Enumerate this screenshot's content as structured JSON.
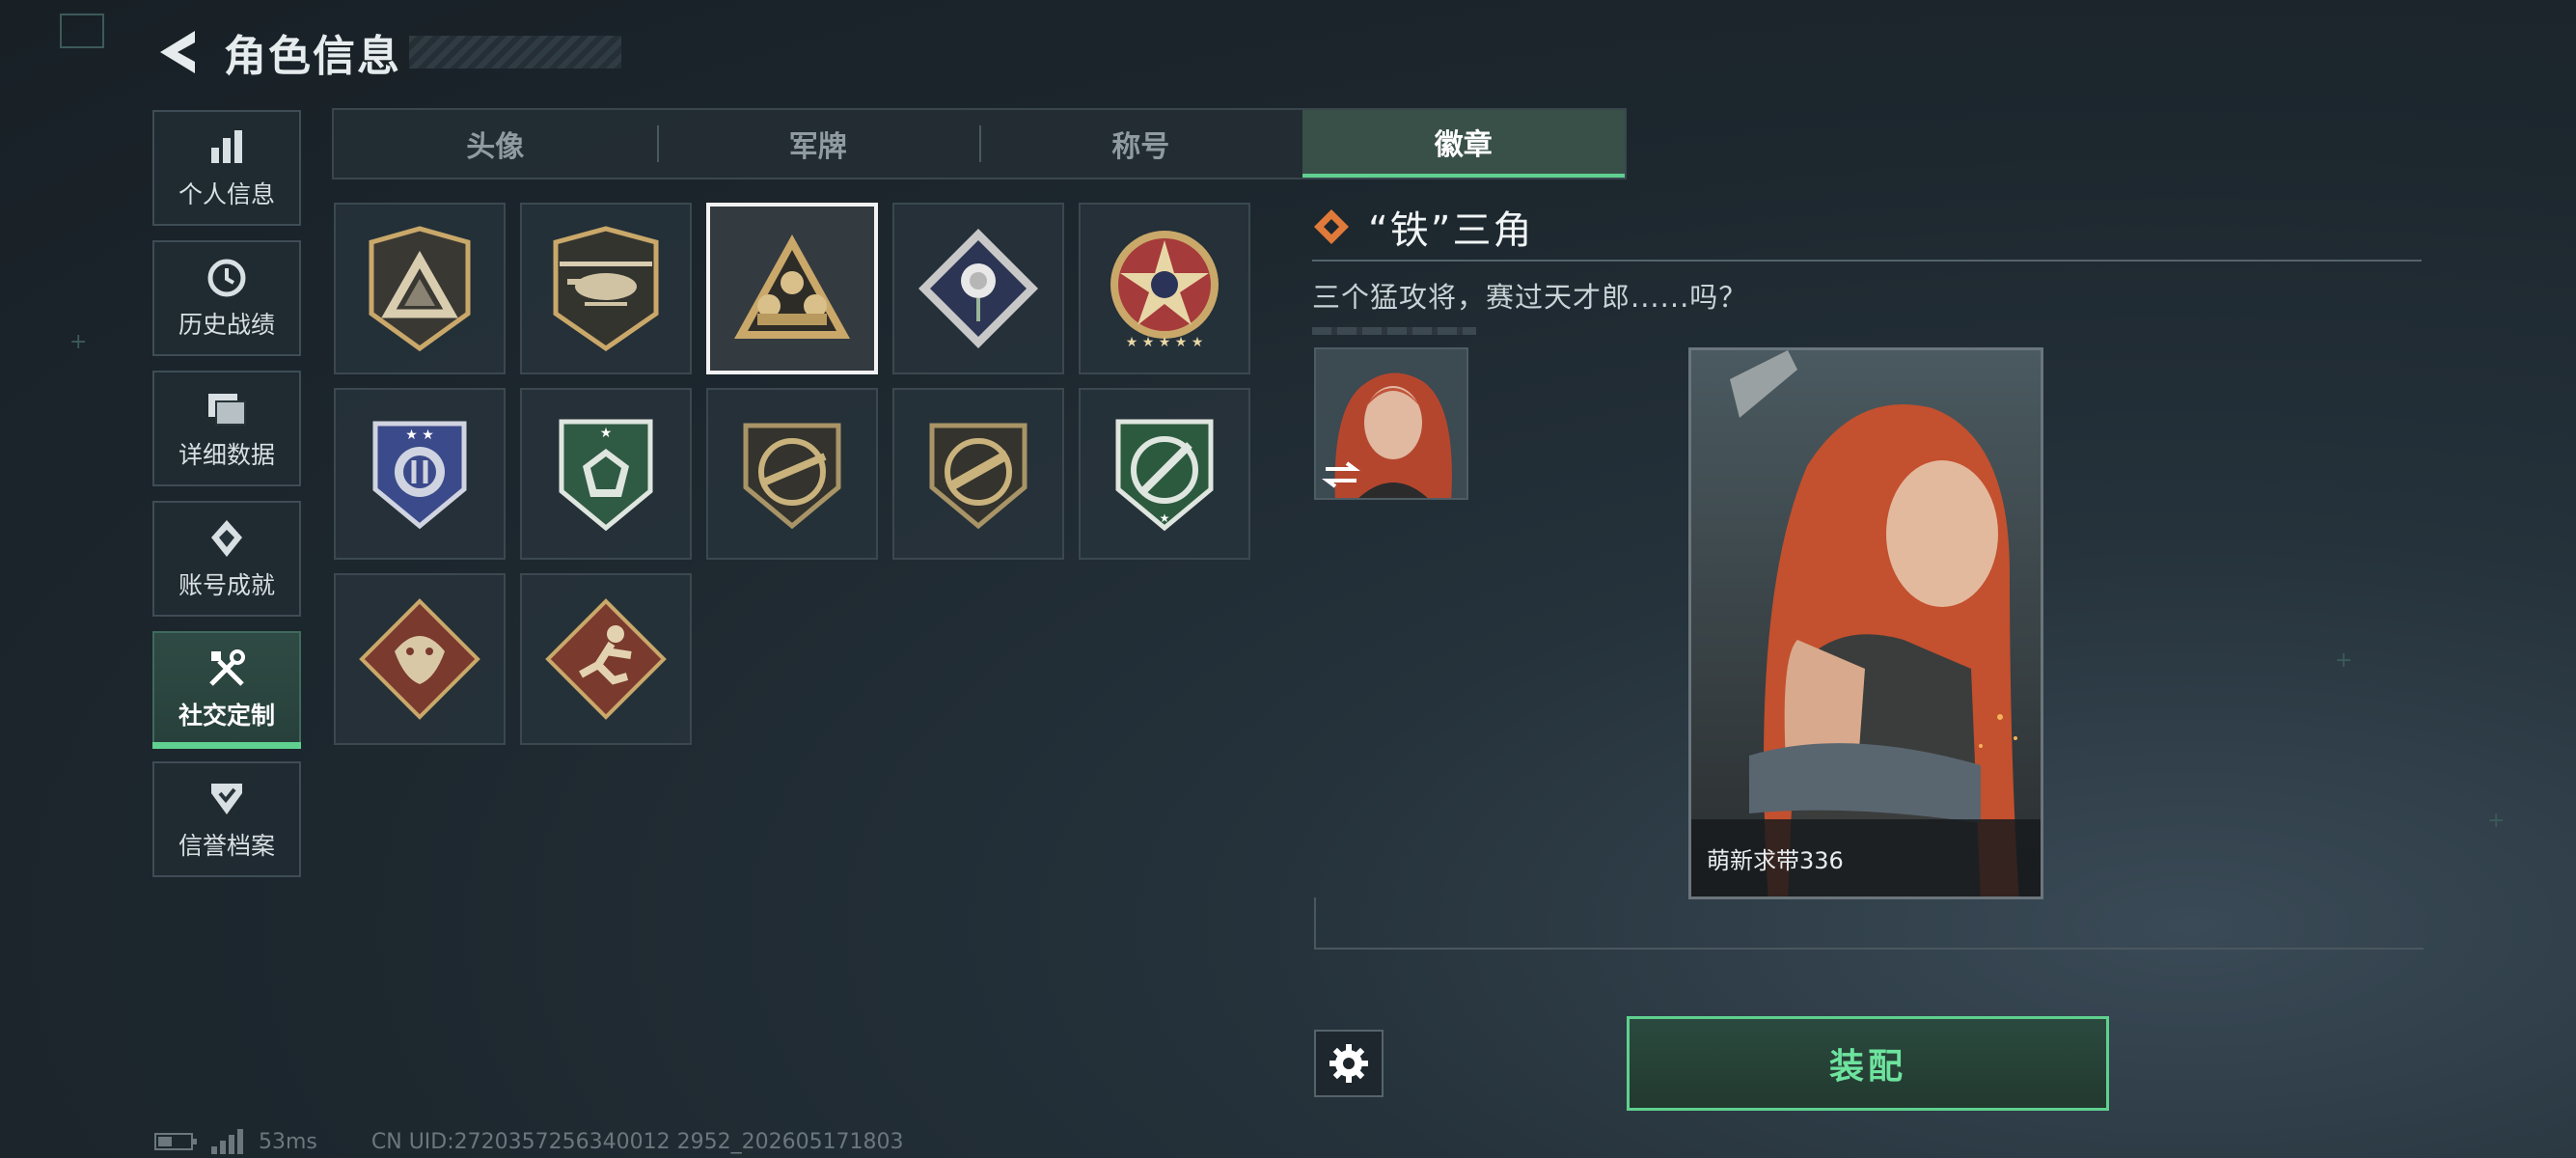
{
  "header": {
    "title": "角色信息",
    "back_icon": "back-arrow-icon"
  },
  "sidebar": {
    "items": [
      {
        "label": "个人信息",
        "icon": "bar-chart-icon",
        "active": false
      },
      {
        "label": "历史战绩",
        "icon": "clock-icon",
        "active": false
      },
      {
        "label": "详细数据",
        "icon": "folder-icon",
        "active": false
      },
      {
        "label": "账号成就",
        "icon": "medal-icon",
        "active": false
      },
      {
        "label": "社交定制",
        "icon": "tools-icon",
        "active": true
      },
      {
        "label": "信誉档案",
        "icon": "shield-check-icon",
        "active": false
      }
    ]
  },
  "tabs": [
    {
      "label": "头像",
      "active": false
    },
    {
      "label": "军牌",
      "active": false
    },
    {
      "label": "称号",
      "active": false
    },
    {
      "label": "徽章",
      "active": true
    }
  ],
  "badges": [
    {
      "name": "triangle-shield-badge",
      "selected": false
    },
    {
      "name": "helicopter-badge",
      "selected": false
    },
    {
      "name": "iron-triangle-badge",
      "selected": true
    },
    {
      "name": "rose-diamond-badge",
      "selected": false
    },
    {
      "name": "star-skull-badge",
      "selected": false
    },
    {
      "name": "blue-wreath-badge",
      "selected": false
    },
    {
      "name": "green-gem-badge",
      "selected": false
    },
    {
      "name": "rifle-crosshair-badge",
      "selected": false
    },
    {
      "name": "smg-crosshair-badge",
      "selected": false
    },
    {
      "name": "knife-crosshair-badge",
      "selected": false
    },
    {
      "name": "dragon-diamond-badge",
      "selected": false
    },
    {
      "name": "runner-diamond-badge",
      "selected": false
    }
  ],
  "detail": {
    "title": "“铁”三角",
    "description": "三个猛攻将，赛过天才郎......吗？",
    "title_icon": "diamond-badge-icon"
  },
  "card": {
    "player_name": "萌新求带336"
  },
  "actions": {
    "equip_label": "装配",
    "settings_icon": "gear-icon",
    "swap_icon": "swap-icon"
  },
  "status": {
    "ping": "53ms",
    "uid": "CN UID:2720357256340012 2952_202605171803"
  },
  "colors": {
    "accent": "#5fd08f",
    "background": "#1d272e",
    "title_icon": "#e07a3a"
  }
}
